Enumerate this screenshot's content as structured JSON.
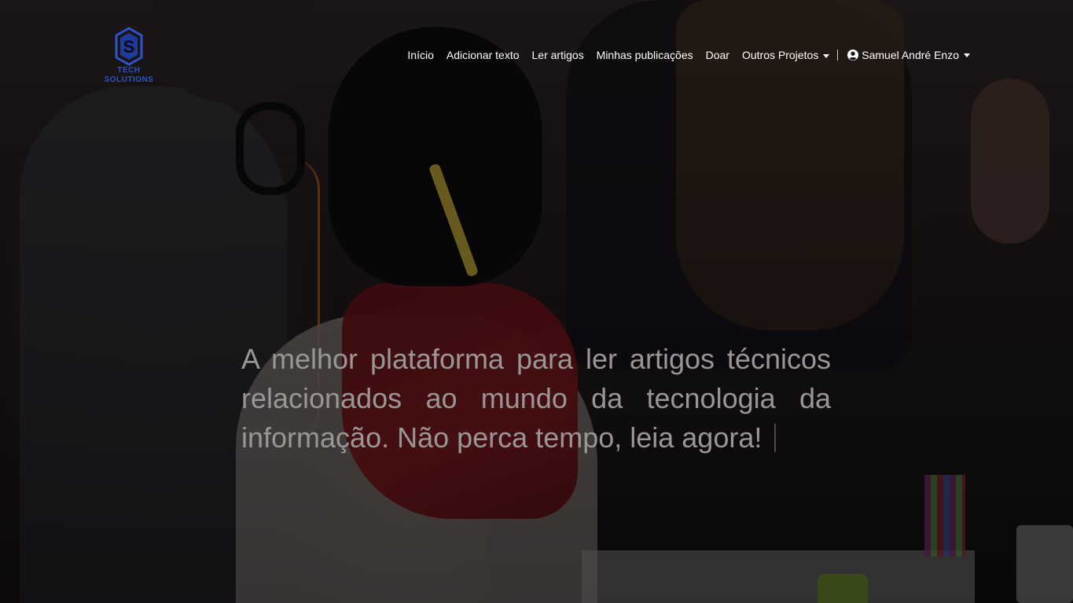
{
  "brand": {
    "logo_letter": "S",
    "line1": "TECH",
    "line2": "SOLUTIONS",
    "color": "#2e54c8"
  },
  "nav": {
    "items": [
      {
        "label": "Início"
      },
      {
        "label": "Adicionar texto"
      },
      {
        "label": "Ler artigos"
      },
      {
        "label": "Minhas publicações"
      },
      {
        "label": "Doar"
      }
    ],
    "dropdown_label": "Outros Projetos",
    "user_name": "Samuel André Enzo",
    "user_icon": "user-circle-icon",
    "caret_icon": "caret-down-icon"
  },
  "hero": {
    "headline": "A melhor plataforma para ler artigos técnicos relacionados ao mundo da tecnologia da informação. Não perca tempo, leia agora!"
  }
}
